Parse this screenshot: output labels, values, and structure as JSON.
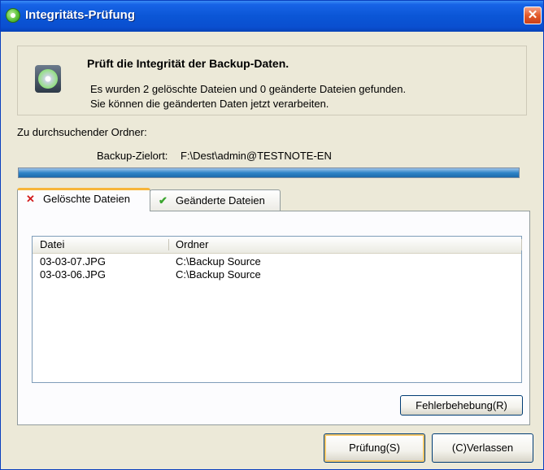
{
  "window": {
    "title": "Integritäts-Prüfung",
    "close_glyph": "✕"
  },
  "header": {
    "title": "Prüft die Integrität der Backup-Daten.",
    "line1": "Es wurden 2 gelöschte Dateien und 0 geänderte Dateien gefunden.",
    "line2": "Sie können die geänderten Daten jetzt verarbeiten."
  },
  "search": {
    "label": "Zu durchsuchender Ordner:",
    "target_label": "Backup-Zielort:",
    "target_value": "F:\\Dest\\admin@TESTNOTE-EN"
  },
  "progress": {
    "percent": 100,
    "color": "#2f84c8"
  },
  "tabs": [
    {
      "label": "Gelöschte Dateien",
      "icon": "x-icon",
      "glyph": "✕",
      "active": true
    },
    {
      "label": "Geänderte Dateien",
      "icon": "check-icon",
      "glyph": "✔",
      "active": false
    }
  ],
  "list": {
    "columns": [
      "Datei",
      "Ordner"
    ],
    "rows": [
      [
        "03-03-07.JPG",
        "C:\\Backup Source"
      ],
      [
        "03-03-06.JPG",
        "C:\\Backup Source"
      ]
    ]
  },
  "buttons": {
    "fix": "Fehlerbehebung(R)",
    "check": "Prüfung(S)",
    "exit": "(C)Verlassen"
  }
}
